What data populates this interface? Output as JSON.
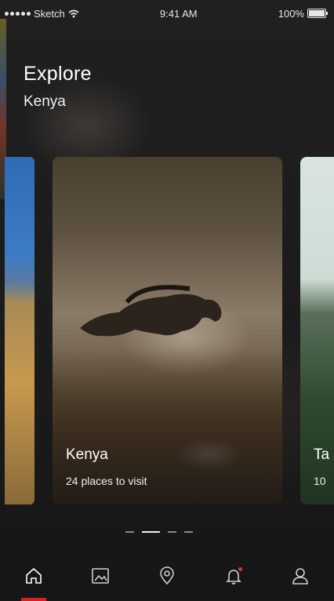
{
  "status_bar": {
    "carrier": "Sketch",
    "time": "9:41 AM",
    "battery": "100%"
  },
  "header": {
    "title": "Explore",
    "subtitle": "Kenya"
  },
  "cards": [
    {
      "name": "Kenya",
      "places": "24 places to visit"
    },
    {
      "name": "Ta",
      "places": "10"
    }
  ],
  "pager": {
    "count": 4,
    "active_index": 1
  },
  "tabbar": {
    "items": [
      "home-icon",
      "gallery-icon",
      "location-pin-icon",
      "bell-icon",
      "profile-icon"
    ],
    "active": "home-icon"
  },
  "colors": {
    "accent": "#d92020",
    "background": "#1a1a1a",
    "text": "#ffffff"
  }
}
